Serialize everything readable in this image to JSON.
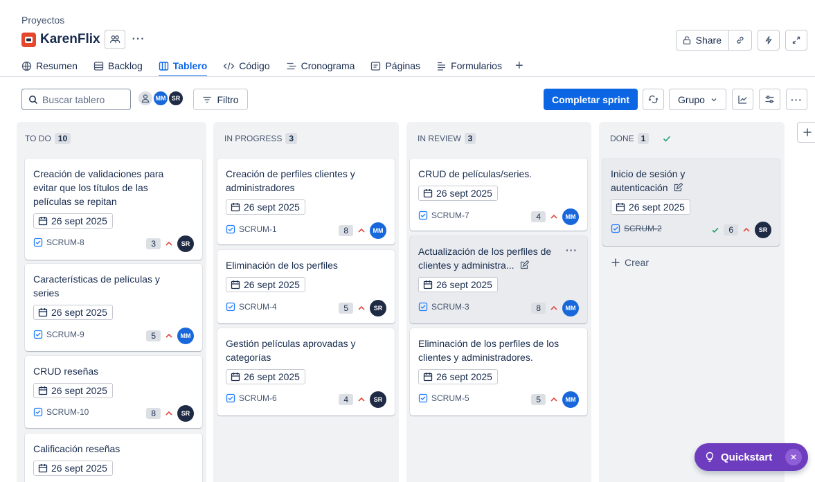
{
  "header": {
    "breadcrumb": "Proyectos",
    "project_name": "KarenFlix",
    "more": "···",
    "share_label": "Share"
  },
  "tabs": [
    {
      "label": "Resumen",
      "icon": "globe-icon"
    },
    {
      "label": "Backlog",
      "icon": "backlog-icon"
    },
    {
      "label": "Tablero",
      "icon": "board-icon",
      "active": true
    },
    {
      "label": "Código",
      "icon": "code-icon"
    },
    {
      "label": "Cronograma",
      "icon": "timeline-icon"
    },
    {
      "label": "Páginas",
      "icon": "pages-icon"
    },
    {
      "label": "Formularios",
      "icon": "forms-icon"
    }
  ],
  "toolbar": {
    "search_placeholder": "Buscar tablero",
    "filter_label": "Filtro",
    "complete_sprint": "Completar sprint",
    "group_label": "Grupo",
    "avatars": [
      "MM",
      "SR"
    ]
  },
  "columns": [
    {
      "name": "TO DO",
      "count": "10",
      "cards": [
        {
          "title": "Creación de validaciones para evitar que los títulos de las películas se repitan",
          "date": "26 sept 2025",
          "key": "SCRUM-8",
          "points": "3",
          "assignee": "SR"
        },
        {
          "title": "Características de películas y series",
          "date": "26 sept 2025",
          "key": "SCRUM-9",
          "points": "5",
          "assignee": "MM"
        },
        {
          "title": "CRUD reseñas",
          "date": "26 sept 2025",
          "key": "SCRUM-10",
          "points": "8",
          "assignee": "SR"
        },
        {
          "title": "Calificación reseñas",
          "date": "26 sept 2025"
        }
      ]
    },
    {
      "name": "IN PROGRESS",
      "count": "3",
      "cards": [
        {
          "title": "Creación de perfiles clientes y administradores",
          "date": "26 sept 2025",
          "key": "SCRUM-1",
          "points": "8",
          "assignee": "MM"
        },
        {
          "title": "Eliminación de los perfiles",
          "date": "26 sept 2025",
          "key": "SCRUM-4",
          "points": "5",
          "assignee": "SR"
        },
        {
          "title": "Gestión películas aprovadas y categorías",
          "date": "26 sept 2025",
          "key": "SCRUM-6",
          "points": "4",
          "assignee": "SR"
        }
      ]
    },
    {
      "name": "IN REVIEW",
      "count": "3",
      "cards": [
        {
          "title": "CRUD de películas/series.",
          "date": "26 sept 2025",
          "key": "SCRUM-7",
          "points": "4",
          "assignee": "MM"
        },
        {
          "title": "Actualización de los perfiles de clientes y administra...",
          "date": "26 sept 2025",
          "key": "SCRUM-3",
          "points": "8",
          "assignee": "MM",
          "more": "···"
        },
        {
          "title": "Eliminación de los perfiles de los clientes y administradores.",
          "date": "26 sept 2025",
          "key": "SCRUM-5",
          "points": "5",
          "assignee": "MM"
        }
      ]
    },
    {
      "name": "DONE",
      "count": "1",
      "cards": [
        {
          "title": "Inicio de sesión y autenticación",
          "date": "26 sept 2025",
          "key": "SCRUM-2",
          "points": "6",
          "assignee": "SR"
        }
      ],
      "create_label": "Crear"
    }
  ],
  "quickstart": {
    "label": "Quickstart"
  },
  "colors": {
    "primary": "#0c66e4",
    "priority": "#e2483d",
    "done_check": "#22a06b",
    "quickstart": "#6e3cbf",
    "avatar_mm": "#1868db",
    "avatar_sr": "#1f2b45"
  }
}
